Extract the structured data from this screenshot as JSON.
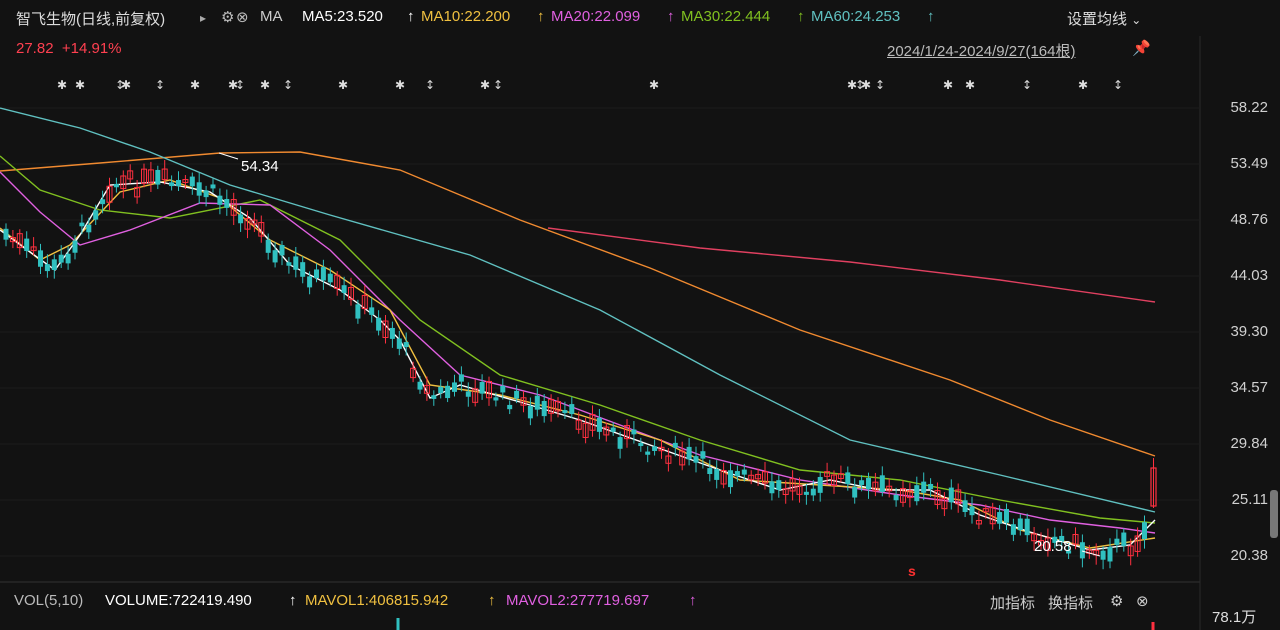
{
  "header": {
    "stock": "智飞生物(日线,前复权)",
    "expand_arrow": "▸",
    "ma_label": "MA",
    "ma5": "MA5:23.520",
    "ma10": "MA10:22.200",
    "ma20": "MA20:22.099",
    "ma30": "MA30:22.444",
    "ma60": "MA60:24.253",
    "up_arrow": "↑",
    "settings": "设置均线",
    "price": "27.82",
    "change": "+14.91%",
    "range": "2024/1/24-2024/9/27(164根)"
  },
  "colors": {
    "ma5": "#ffffff",
    "ma10": "#f0c040",
    "ma20": "#e060e0",
    "ma30": "#80c020",
    "ma60": "#60c0c0",
    "ma120": "#f08a30",
    "ma250": "#e04060",
    "up": "#ff3040",
    "down": "#30c0c0"
  },
  "y_axis": [
    "58.22",
    "53.49",
    "48.76",
    "44.03",
    "39.30",
    "34.57",
    "29.84",
    "25.11",
    "20.38"
  ],
  "annotations": {
    "high": "54.34",
    "low": "20.58",
    "signal": "s"
  },
  "volume_bar": {
    "label": "VOL(5,10)",
    "volume": "VOLUME:722419.490",
    "mavol1": "MAVOL1:406815.942",
    "mavol2": "MAVOL2:277719.697",
    "add_indicator": "加指标",
    "switch_indicator": "换指标",
    "axis_top": "78.1万"
  }
}
